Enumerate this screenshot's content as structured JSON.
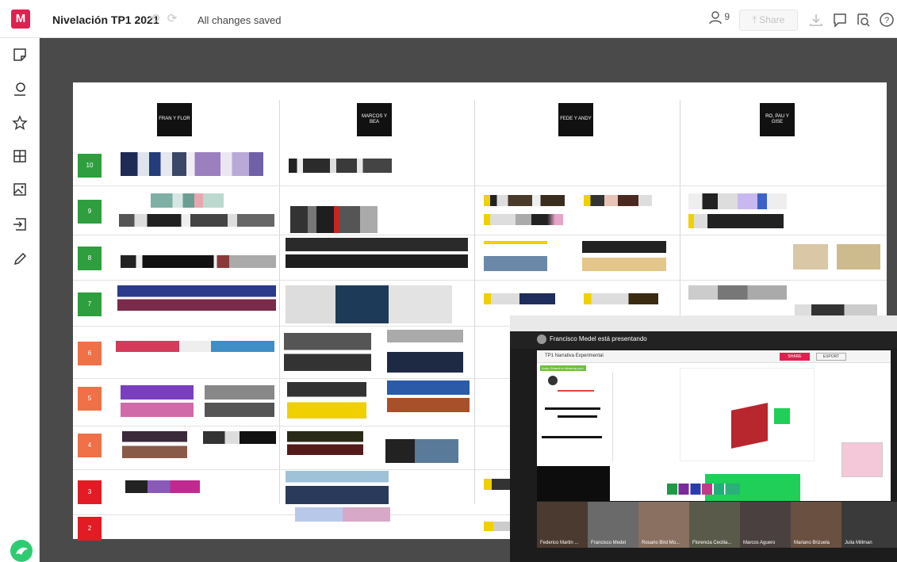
{
  "header": {
    "logo_letter": "M",
    "title": "Nivelación TP1 2021",
    "save_status": "All changes saved",
    "collaborator_count": "9",
    "share_label": "Share"
  },
  "left_toolbar": {
    "tools": [
      "sticky-note-icon",
      "comment-icon",
      "star-icon",
      "grid-icon",
      "image-icon",
      "import-icon",
      "pen-icon"
    ]
  },
  "board": {
    "teams": [
      {
        "label": "FRAN Y FLOR"
      },
      {
        "label": "MARCOS Y BEA"
      },
      {
        "label": "FEDE Y ANDY"
      },
      {
        "label": "RO, PAU Y GISE"
      }
    ],
    "scores": [
      {
        "value": "10",
        "color": "#2e9e3e"
      },
      {
        "value": "9",
        "color": "#2e9e3e"
      },
      {
        "value": "8",
        "color": "#2e9e3e"
      },
      {
        "value": "7",
        "color": "#2e9e3e"
      },
      {
        "value": "6",
        "color": "#f07048"
      },
      {
        "value": "5",
        "color": "#f07048"
      },
      {
        "value": "4",
        "color": "#f07048"
      },
      {
        "value": "3",
        "color": "#e21b24"
      },
      {
        "value": "2",
        "color": "#e21b24"
      }
    ]
  },
  "video_call": {
    "presenter_text": "Francisco Medel está presentando",
    "shared_title": "TP1 Narrativa Experimental",
    "shared_share": "SHARE",
    "shared_export": "EXPORT",
    "following_text": "Andy Ortandi is following you!",
    "participants": [
      "Federico Martin ...",
      "Francisco Medel",
      "Rosario Bird Mo...",
      "Florencia Cecilia...",
      "Marcos Aguero",
      "Mariano Brizuela",
      "Julia Millman"
    ]
  },
  "colors": {
    "brand": "#e0204f",
    "score_green": "#2e9e3e",
    "score_orange": "#f07048",
    "score_red": "#e21b24",
    "canvas_bg": "#4a4a4a"
  }
}
